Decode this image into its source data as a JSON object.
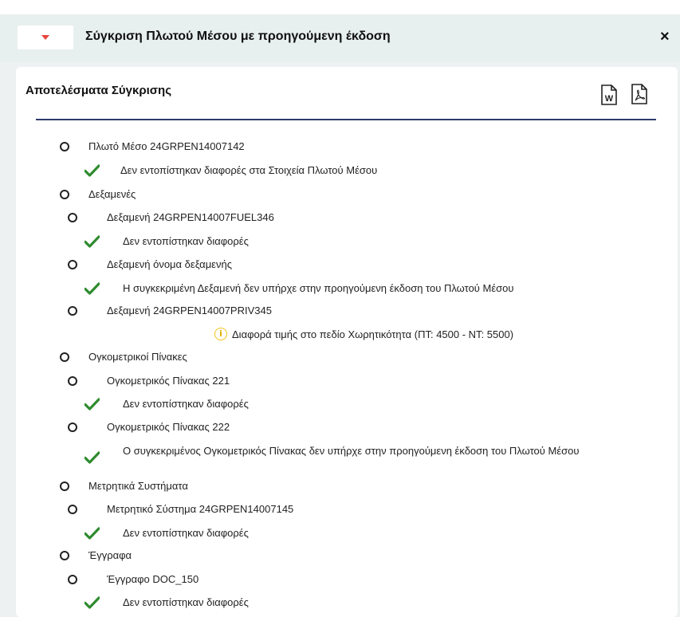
{
  "dialog": {
    "title": "Σύγκριση Πλωτού Μέσου με προηγούμενη έκδοση",
    "close_label": "×"
  },
  "card": {
    "title": "Αποτελέσματα Σύγκρισης",
    "word_label": "W"
  },
  "tree": [
    {
      "type": "node",
      "level": 0,
      "label": "Πλωτό Μέσο 24GRPEN14007142"
    },
    {
      "type": "ok",
      "level": 0,
      "label": "Δεν εντοπίστηκαν διαφορές στα Στοιχεία Πλωτού Μέσου"
    },
    {
      "type": "node",
      "level": 0,
      "label": "Δεξαμενές"
    },
    {
      "type": "node",
      "level": 1,
      "label": "Δεξαμενή 24GRPEN14007FUEL346"
    },
    {
      "type": "ok",
      "level": 1,
      "label": "Δεν εντοπίστηκαν διαφορές"
    },
    {
      "type": "node",
      "level": 1,
      "label": "Δεξαμενή όνομα δεξαμενής"
    },
    {
      "type": "ok",
      "level": 1,
      "label": "Η συγκεκριμένη Δεξαμενή δεν υπήρχε στην προηγούμενη έκδοση του Πλωτού Μέσου"
    },
    {
      "type": "node",
      "level": 1,
      "label": "Δεξαμενή 24GRPEN14007PRIV345"
    },
    {
      "type": "info",
      "level": 1,
      "label": "Διαφορά τιμής στο πεδίο Χωρητικότητα (ΠΤ: 4500 - ΝΤ: 5500)"
    },
    {
      "type": "node",
      "level": 0,
      "label": "Ογκομετρικοί Πίνακες"
    },
    {
      "type": "node",
      "level": 1,
      "label": "Ογκομετρικός Πίνακας 221"
    },
    {
      "type": "ok",
      "level": 1,
      "label": "Δεν εντοπίστηκαν διαφορές"
    },
    {
      "type": "node",
      "level": 1,
      "label": "Ογκομετρικός Πίνακας 222"
    },
    {
      "type": "ok",
      "level": 1,
      "label": "Ο συγκεκριμένος Ογκομετρικός Πίνακας δεν υπήρχε στην προηγούμενη έκδοση του Πλωτού Μέσου"
    },
    {
      "type": "node",
      "level": 0,
      "label": "Μετρητικά Συστήματα"
    },
    {
      "type": "node",
      "level": 1,
      "label": "Μετρητικό Σύστημα 24GRPEN14007145"
    },
    {
      "type": "ok",
      "level": 1,
      "label": "Δεν εντοπίστηκαν διαφορές"
    },
    {
      "type": "node",
      "level": 0,
      "label": "Έγγραφα"
    },
    {
      "type": "node",
      "level": 1,
      "label": "Έγγραφο DOC_150"
    },
    {
      "type": "ok",
      "level": 1,
      "label": "Δεν εντοπίστηκαν διαφορές"
    }
  ],
  "colors": {
    "accent_red": "#e8453c",
    "check_green": "#2e8b2e",
    "info_yellow": "#f0c419",
    "divider_navy": "#2d3e6b"
  }
}
